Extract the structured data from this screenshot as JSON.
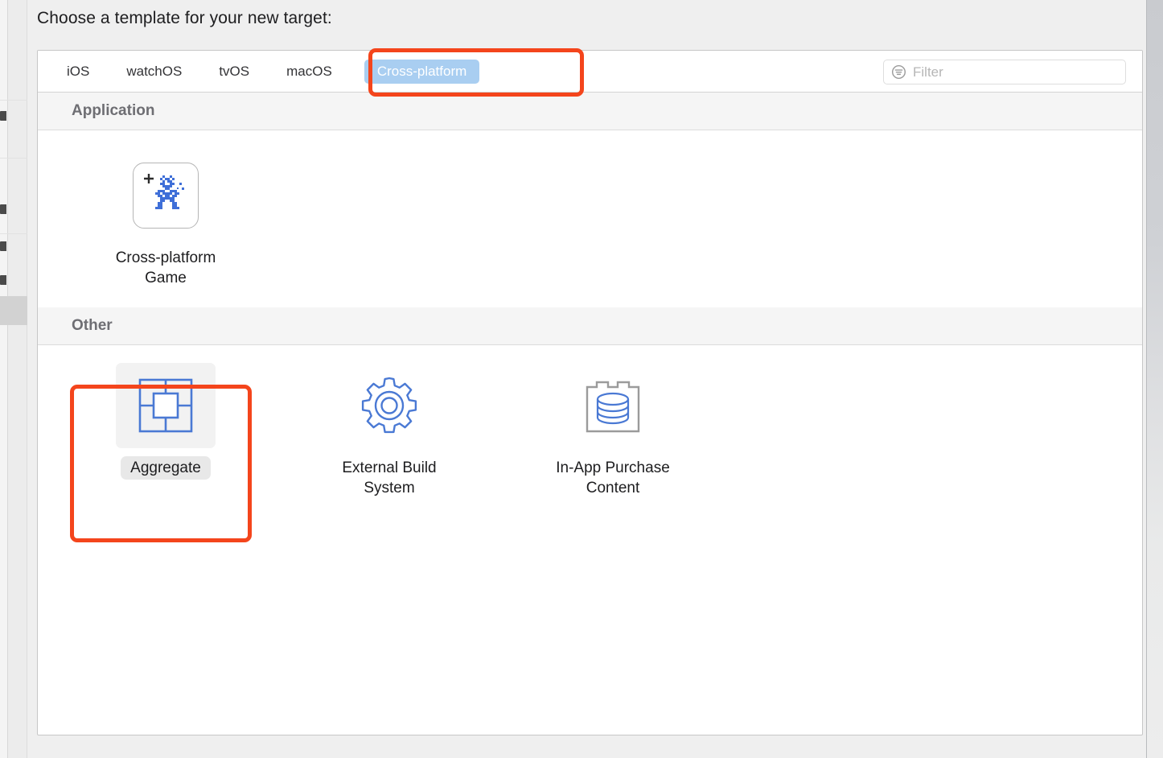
{
  "page": {
    "title": "Choose a template for your new target:",
    "background_color": "#efefef",
    "annotation_color": "#f4451c",
    "accent_blue": "#a9cef1",
    "icon_blue": "#4a79d4"
  },
  "tabs": [
    {
      "label": "iOS",
      "selected": false
    },
    {
      "label": "watchOS",
      "selected": false
    },
    {
      "label": "tvOS",
      "selected": false
    },
    {
      "label": "macOS",
      "selected": false
    },
    {
      "label": "Cross-platform",
      "selected": true
    }
  ],
  "filter": {
    "placeholder": "Filter",
    "value": "",
    "icon": "filter-icon"
  },
  "groups": [
    {
      "header": "Application",
      "items": [
        {
          "label": "Cross-platform\nGame",
          "icon": "pixel-robot-game-icon",
          "selected": false
        }
      ]
    },
    {
      "header": "Other",
      "items": [
        {
          "label": "Aggregate",
          "icon": "aggregate-grid-icon",
          "selected": true
        },
        {
          "label": "External Build\nSystem",
          "icon": "gear-icon",
          "selected": false
        },
        {
          "label": "In-App Purchase\nContent",
          "icon": "in-app-purchase-crate-icon",
          "selected": false
        }
      ]
    }
  ],
  "annotations": [
    {
      "name": "cross-platform-tab-highlight",
      "target": "Cross-platform"
    },
    {
      "name": "aggregate-template-highlight",
      "target": "Aggregate"
    }
  ]
}
